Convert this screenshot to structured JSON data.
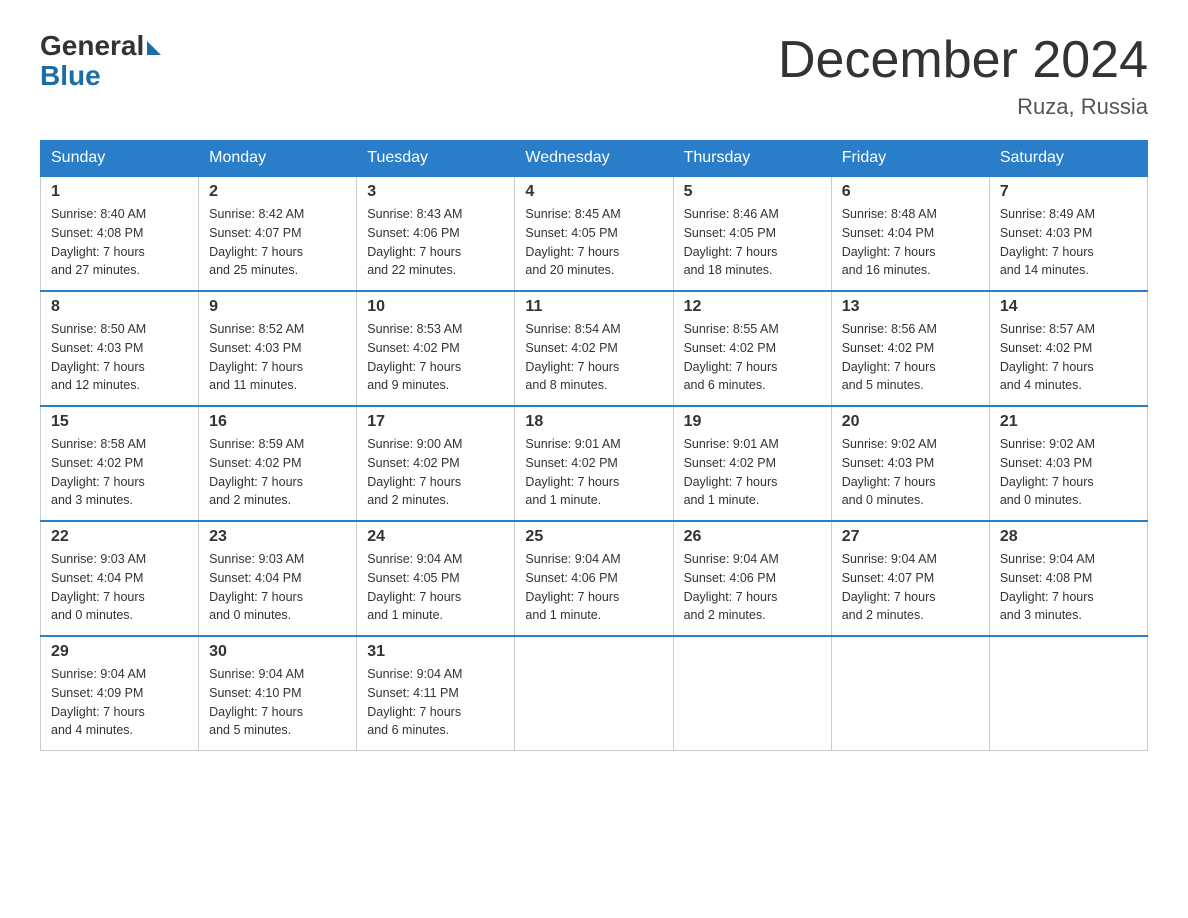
{
  "logo": {
    "general": "General",
    "blue": "Blue"
  },
  "header": {
    "title": "December 2024",
    "location": "Ruza, Russia"
  },
  "weekdays": [
    "Sunday",
    "Monday",
    "Tuesday",
    "Wednesday",
    "Thursday",
    "Friday",
    "Saturday"
  ],
  "weeks": [
    [
      {
        "day": "1",
        "sunrise": "8:40 AM",
        "sunset": "4:08 PM",
        "daylight": "7 hours and 27 minutes."
      },
      {
        "day": "2",
        "sunrise": "8:42 AM",
        "sunset": "4:07 PM",
        "daylight": "7 hours and 25 minutes."
      },
      {
        "day": "3",
        "sunrise": "8:43 AM",
        "sunset": "4:06 PM",
        "daylight": "7 hours and 22 minutes."
      },
      {
        "day": "4",
        "sunrise": "8:45 AM",
        "sunset": "4:05 PM",
        "daylight": "7 hours and 20 minutes."
      },
      {
        "day": "5",
        "sunrise": "8:46 AM",
        "sunset": "4:05 PM",
        "daylight": "7 hours and 18 minutes."
      },
      {
        "day": "6",
        "sunrise": "8:48 AM",
        "sunset": "4:04 PM",
        "daylight": "7 hours and 16 minutes."
      },
      {
        "day": "7",
        "sunrise": "8:49 AM",
        "sunset": "4:03 PM",
        "daylight": "7 hours and 14 minutes."
      }
    ],
    [
      {
        "day": "8",
        "sunrise": "8:50 AM",
        "sunset": "4:03 PM",
        "daylight": "7 hours and 12 minutes."
      },
      {
        "day": "9",
        "sunrise": "8:52 AM",
        "sunset": "4:03 PM",
        "daylight": "7 hours and 11 minutes."
      },
      {
        "day": "10",
        "sunrise": "8:53 AM",
        "sunset": "4:02 PM",
        "daylight": "7 hours and 9 minutes."
      },
      {
        "day": "11",
        "sunrise": "8:54 AM",
        "sunset": "4:02 PM",
        "daylight": "7 hours and 8 minutes."
      },
      {
        "day": "12",
        "sunrise": "8:55 AM",
        "sunset": "4:02 PM",
        "daylight": "7 hours and 6 minutes."
      },
      {
        "day": "13",
        "sunrise": "8:56 AM",
        "sunset": "4:02 PM",
        "daylight": "7 hours and 5 minutes."
      },
      {
        "day": "14",
        "sunrise": "8:57 AM",
        "sunset": "4:02 PM",
        "daylight": "7 hours and 4 minutes."
      }
    ],
    [
      {
        "day": "15",
        "sunrise": "8:58 AM",
        "sunset": "4:02 PM",
        "daylight": "7 hours and 3 minutes."
      },
      {
        "day": "16",
        "sunrise": "8:59 AM",
        "sunset": "4:02 PM",
        "daylight": "7 hours and 2 minutes."
      },
      {
        "day": "17",
        "sunrise": "9:00 AM",
        "sunset": "4:02 PM",
        "daylight": "7 hours and 2 minutes."
      },
      {
        "day": "18",
        "sunrise": "9:01 AM",
        "sunset": "4:02 PM",
        "daylight": "7 hours and 1 minute."
      },
      {
        "day": "19",
        "sunrise": "9:01 AM",
        "sunset": "4:02 PM",
        "daylight": "7 hours and 1 minute."
      },
      {
        "day": "20",
        "sunrise": "9:02 AM",
        "sunset": "4:03 PM",
        "daylight": "7 hours and 0 minutes."
      },
      {
        "day": "21",
        "sunrise": "9:02 AM",
        "sunset": "4:03 PM",
        "daylight": "7 hours and 0 minutes."
      }
    ],
    [
      {
        "day": "22",
        "sunrise": "9:03 AM",
        "sunset": "4:04 PM",
        "daylight": "7 hours and 0 minutes."
      },
      {
        "day": "23",
        "sunrise": "9:03 AM",
        "sunset": "4:04 PM",
        "daylight": "7 hours and 0 minutes."
      },
      {
        "day": "24",
        "sunrise": "9:04 AM",
        "sunset": "4:05 PM",
        "daylight": "7 hours and 1 minute."
      },
      {
        "day": "25",
        "sunrise": "9:04 AM",
        "sunset": "4:06 PM",
        "daylight": "7 hours and 1 minute."
      },
      {
        "day": "26",
        "sunrise": "9:04 AM",
        "sunset": "4:06 PM",
        "daylight": "7 hours and 2 minutes."
      },
      {
        "day": "27",
        "sunrise": "9:04 AM",
        "sunset": "4:07 PM",
        "daylight": "7 hours and 2 minutes."
      },
      {
        "day": "28",
        "sunrise": "9:04 AM",
        "sunset": "4:08 PM",
        "daylight": "7 hours and 3 minutes."
      }
    ],
    [
      {
        "day": "29",
        "sunrise": "9:04 AM",
        "sunset": "4:09 PM",
        "daylight": "7 hours and 4 minutes."
      },
      {
        "day": "30",
        "sunrise": "9:04 AM",
        "sunset": "4:10 PM",
        "daylight": "7 hours and 5 minutes."
      },
      {
        "day": "31",
        "sunrise": "9:04 AM",
        "sunset": "4:11 PM",
        "daylight": "7 hours and 6 minutes."
      },
      null,
      null,
      null,
      null
    ]
  ],
  "labels": {
    "sunrise": "Sunrise:",
    "sunset": "Sunset:",
    "daylight": "Daylight:"
  }
}
